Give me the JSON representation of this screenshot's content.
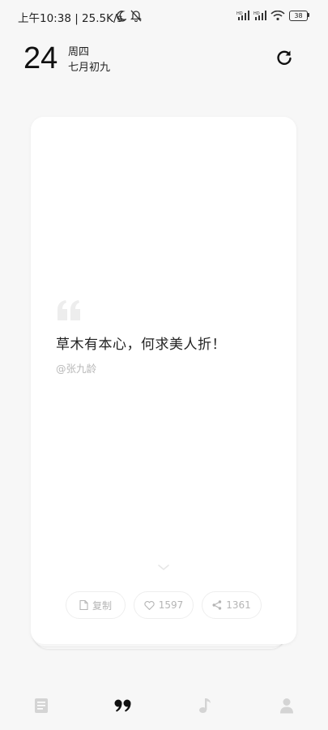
{
  "status_bar": {
    "time_speed": "上午10:38 | 25.5K/s",
    "battery": "38"
  },
  "header": {
    "day": "24",
    "weekday": "周四",
    "lunar_date": "七月初九"
  },
  "quote": {
    "text": "草木有本心，何求美人折！",
    "author": "@张九龄"
  },
  "actions": {
    "copy_label": "复制",
    "like_count": "1597",
    "share_count": "1361"
  },
  "bottom_nav": {
    "items": [
      {
        "icon": "document-icon",
        "active": false
      },
      {
        "icon": "quote-icon",
        "active": true
      },
      {
        "icon": "music-note-icon",
        "active": false
      },
      {
        "icon": "person-icon",
        "active": false
      }
    ]
  },
  "colors": {
    "background": "#f7f7f7",
    "card": "#ffffff",
    "muted": "#b5b5b5",
    "nav_inactive": "#d4d4d4",
    "nav_active": "#111111"
  }
}
